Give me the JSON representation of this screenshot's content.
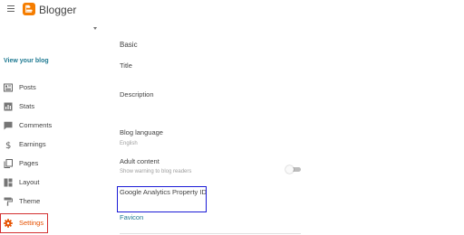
{
  "header": {
    "app_name": "Blogger"
  },
  "sidebar": {
    "view_blog": "View your blog",
    "items": [
      {
        "label": "Posts",
        "icon": "posts-icon"
      },
      {
        "label": "Stats",
        "icon": "stats-icon"
      },
      {
        "label": "Comments",
        "icon": "comments-icon"
      },
      {
        "label": "Earnings",
        "icon": "earnings-icon"
      },
      {
        "label": "Pages",
        "icon": "pages-icon"
      },
      {
        "label": "Layout",
        "icon": "layout-icon"
      },
      {
        "label": "Theme",
        "icon": "theme-icon"
      },
      {
        "label": "Settings",
        "icon": "settings-gear-icon",
        "active": true
      }
    ]
  },
  "main": {
    "section_title": "Basic",
    "title_label": "Title",
    "description_label": "Description",
    "blog_language_label": "Blog language",
    "blog_language_value": "English",
    "adult_content_label": "Adult content",
    "adult_content_sub": "Show warning to blog readers",
    "adult_content_enabled": false,
    "ga_label": "Google Analytics Property ID",
    "favicon_label": "Favicon"
  },
  "colors": {
    "brand": "#f57d00",
    "link": "#1f7a92",
    "active_nav": "#e65100",
    "settings_highlight": "#d32f2f",
    "ga_highlight": "#1a1ad6"
  }
}
